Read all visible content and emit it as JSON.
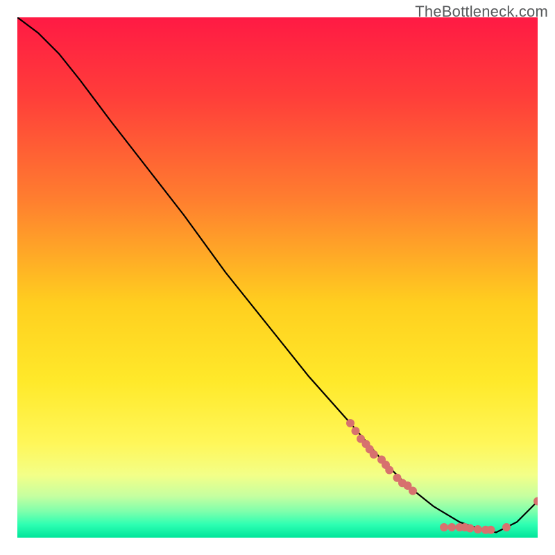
{
  "watermark": "TheBottleneck.com",
  "chart_data": {
    "type": "line",
    "title": "",
    "xlabel": "",
    "ylabel": "",
    "xlim": [
      0,
      100
    ],
    "ylim": [
      0,
      100
    ],
    "gradient_stops": [
      {
        "offset": 0.0,
        "color": "#ff1a44"
      },
      {
        "offset": 0.15,
        "color": "#ff3d3a"
      },
      {
        "offset": 0.35,
        "color": "#ff7e2f"
      },
      {
        "offset": 0.55,
        "color": "#ffcf1f"
      },
      {
        "offset": 0.7,
        "color": "#ffe92a"
      },
      {
        "offset": 0.82,
        "color": "#fff75a"
      },
      {
        "offset": 0.88,
        "color": "#f3ff88"
      },
      {
        "offset": 0.92,
        "color": "#c6ffa0"
      },
      {
        "offset": 0.95,
        "color": "#7dffac"
      },
      {
        "offset": 0.975,
        "color": "#2dffb2"
      },
      {
        "offset": 1.0,
        "color": "#00e59a"
      }
    ],
    "series": [
      {
        "name": "bottleneck-curve",
        "color": "#000000",
        "x": [
          0,
          4,
          8,
          12,
          18,
          25,
          32,
          40,
          48,
          56,
          64,
          70,
          75,
          80,
          85,
          88,
          92,
          96,
          100
        ],
        "y": [
          100,
          97,
          93,
          88,
          80,
          71,
          62,
          51,
          41,
          31,
          22,
          15,
          10,
          6,
          3,
          2,
          1,
          3,
          7
        ]
      }
    ],
    "highlight_points": {
      "color": "#d7716e",
      "radius": 6,
      "points": [
        {
          "x": 64,
          "y": 22
        },
        {
          "x": 65,
          "y": 20.5
        },
        {
          "x": 66,
          "y": 19
        },
        {
          "x": 67,
          "y": 18
        },
        {
          "x": 67.7,
          "y": 17
        },
        {
          "x": 68.5,
          "y": 16
        },
        {
          "x": 70,
          "y": 15
        },
        {
          "x": 70.8,
          "y": 14
        },
        {
          "x": 71.5,
          "y": 13
        },
        {
          "x": 73,
          "y": 11.5
        },
        {
          "x": 74,
          "y": 10.5
        },
        {
          "x": 75,
          "y": 10
        },
        {
          "x": 76,
          "y": 9
        },
        {
          "x": 82,
          "y": 2
        },
        {
          "x": 83.5,
          "y": 2
        },
        {
          "x": 85,
          "y": 2
        },
        {
          "x": 86,
          "y": 2
        },
        {
          "x": 87,
          "y": 1.8
        },
        {
          "x": 88.5,
          "y": 1.6
        },
        {
          "x": 90,
          "y": 1.5
        },
        {
          "x": 91,
          "y": 1.5
        },
        {
          "x": 94,
          "y": 2
        },
        {
          "x": 100,
          "y": 7
        }
      ]
    }
  }
}
